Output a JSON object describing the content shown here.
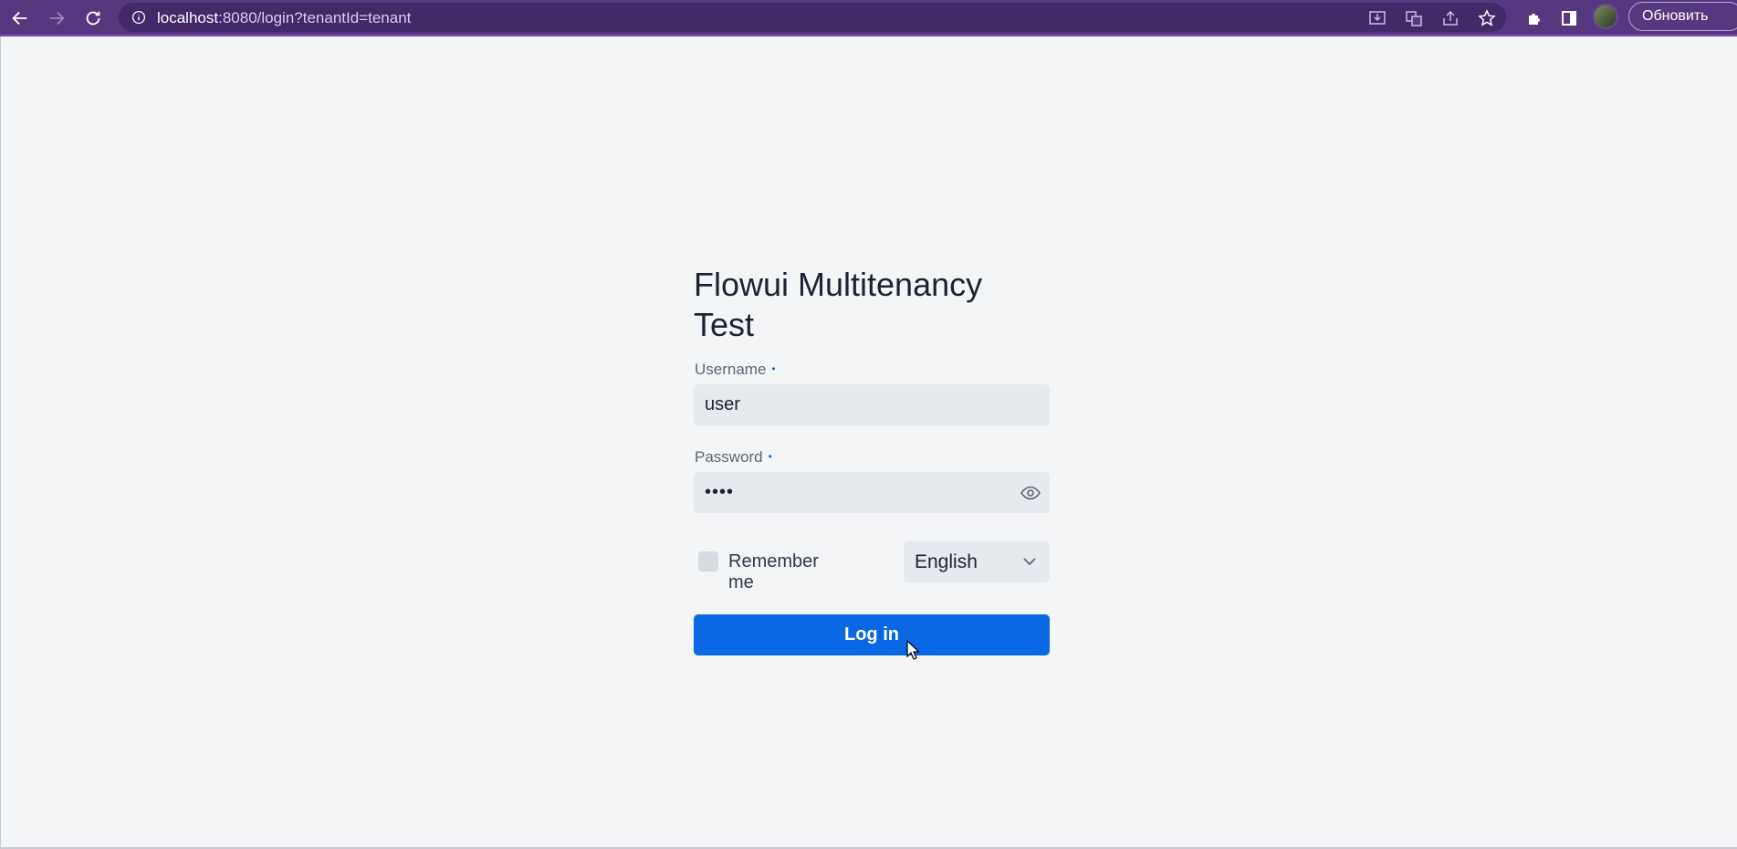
{
  "browser": {
    "url_host": "localhost",
    "url_rest": ":8080/login?tenantId=tenant",
    "update_label": "Обновить",
    "icons": [
      "back-icon",
      "forward-icon",
      "reload-icon",
      "info-icon",
      "install-app-icon",
      "translate-icon",
      "share-icon",
      "bookmark-star-icon",
      "extensions-icon",
      "side-panel-icon"
    ]
  },
  "login": {
    "title": "Flowui Multitenancy Test",
    "username_label": "Username",
    "username_value": "user",
    "password_label": "Password",
    "password_value": "••••",
    "required_marker": "•",
    "remember_label": "Remember me",
    "remember_checked": false,
    "language_value": "English",
    "login_button_label": "Log in"
  },
  "colors": {
    "chrome": "#553880",
    "page_bg": "#f3f5f7",
    "primary": "#0a68e4"
  }
}
